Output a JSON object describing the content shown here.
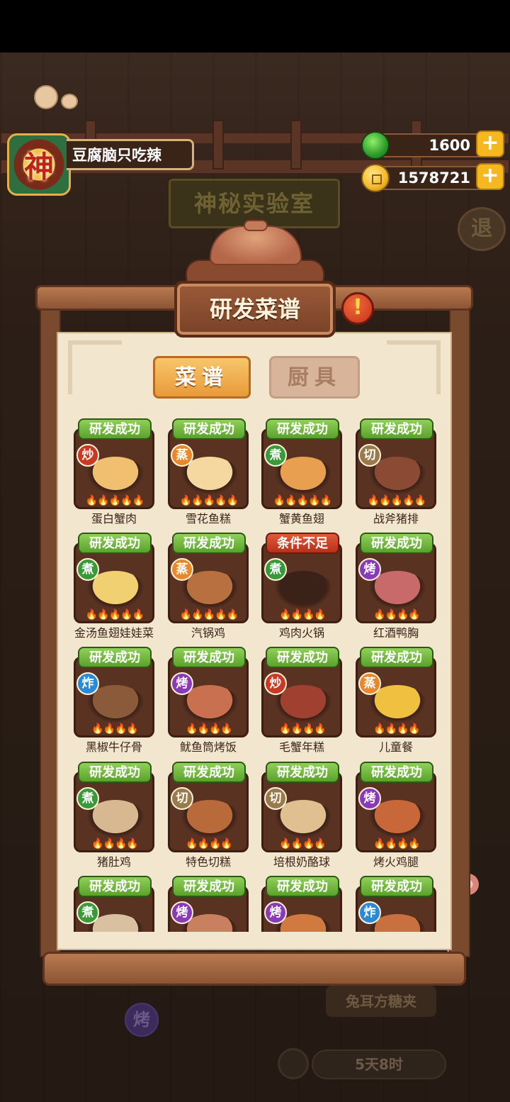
{
  "player": {
    "avatar_char": "神",
    "name": "豆腐脑只吃辣"
  },
  "currencies": {
    "gems": "1600",
    "coins": "1578721",
    "add_label": "+"
  },
  "background": {
    "lab_title": "神秘实验室",
    "exit_label": "退",
    "dish_label": "兔耳方糖夹",
    "method_label": "烤",
    "timer": "5天8时"
  },
  "panel": {
    "title": "研发菜谱",
    "info_label": "!"
  },
  "tabs": [
    {
      "label": "菜谱",
      "active": true
    },
    {
      "label": "厨具",
      "active": false
    }
  ],
  "method_colors": {
    "炒": "#c83a22",
    "蒸": "#e8882a",
    "煮": "#3a9a3a",
    "切": "#9a7a4a",
    "烤": "#8a3ab8",
    "炸": "#2a8ad8"
  },
  "recipes": [
    {
      "status": "研发成功",
      "method": "炒",
      "name": "蛋白蟹肉",
      "flames": "🔥🔥🔥🔥🔥",
      "color": "#f0c070"
    },
    {
      "status": "研发成功",
      "method": "蒸",
      "name": "雪花鱼糕",
      "flames": "🔥🔥🔥🔥🔥",
      "color": "#f4d8a0"
    },
    {
      "status": "研发成功",
      "method": "煮",
      "name": "蟹黄鱼翅",
      "flames": "🔥🔥🔥🔥🔥",
      "color": "#e8a050"
    },
    {
      "status": "研发成功",
      "method": "切",
      "name": "战斧猪排",
      "flames": "🔥🔥🔥🔥🔥",
      "color": "#8a4a34"
    },
    {
      "status": "研发成功",
      "method": "煮",
      "name": "金汤鱼翅娃娃菜",
      "flames": "🔥🔥🔥🔥🔥",
      "color": "#f0d070"
    },
    {
      "status": "研发成功",
      "method": "蒸",
      "name": "汽锅鸡",
      "flames": "🔥🔥🔥🔥🔥",
      "color": "#b87040"
    },
    {
      "status": "条件不足",
      "method": "煮",
      "name": "鸡肉火锅",
      "flames": "🔥🔥🔥🔥",
      "color": "#3a2218"
    },
    {
      "status": "研发成功",
      "method": "烤",
      "name": "红酒鸭胸",
      "flames": "🔥🔥🔥🔥",
      "color": "#c86a6a"
    },
    {
      "status": "研发成功",
      "method": "炸",
      "name": "黑椒牛仔骨",
      "flames": "🔥🔥🔥🔥",
      "color": "#8a5a3a"
    },
    {
      "status": "研发成功",
      "method": "烤",
      "name": "鱿鱼筒烤饭",
      "flames": "🔥🔥🔥🔥",
      "color": "#c87050"
    },
    {
      "status": "研发成功",
      "method": "炒",
      "name": "毛蟹年糕",
      "flames": "🔥🔥🔥🔥",
      "color": "#a04030"
    },
    {
      "status": "研发成功",
      "method": "蒸",
      "name": "儿童餐",
      "flames": "🔥🔥🔥🔥",
      "color": "#f0c040"
    },
    {
      "status": "研发成功",
      "method": "煮",
      "name": "猪肚鸡",
      "flames": "🔥🔥🔥🔥",
      "color": "#d8b890"
    },
    {
      "status": "研发成功",
      "method": "切",
      "name": "特色切糕",
      "flames": "🔥🔥🔥🔥",
      "color": "#b86a3a"
    },
    {
      "status": "研发成功",
      "method": "切",
      "name": "培根奶酪球",
      "flames": "🔥🔥🔥🔥",
      "color": "#e0c090"
    },
    {
      "status": "研发成功",
      "method": "烤",
      "name": "烤火鸡腿",
      "flames": "🔥🔥🔥🔥",
      "color": "#c8683a"
    },
    {
      "status": "研发成功",
      "method": "煮",
      "name": "",
      "flames": "",
      "color": "#d8c0a0"
    },
    {
      "status": "研发成功",
      "method": "烤",
      "name": "",
      "flames": "",
      "color": "#c88060"
    },
    {
      "status": "研发成功",
      "method": "烤",
      "name": "",
      "flames": "",
      "color": "#d07a40"
    },
    {
      "status": "研发成功",
      "method": "炸",
      "name": "",
      "flames": "",
      "color": "#c87040"
    }
  ]
}
